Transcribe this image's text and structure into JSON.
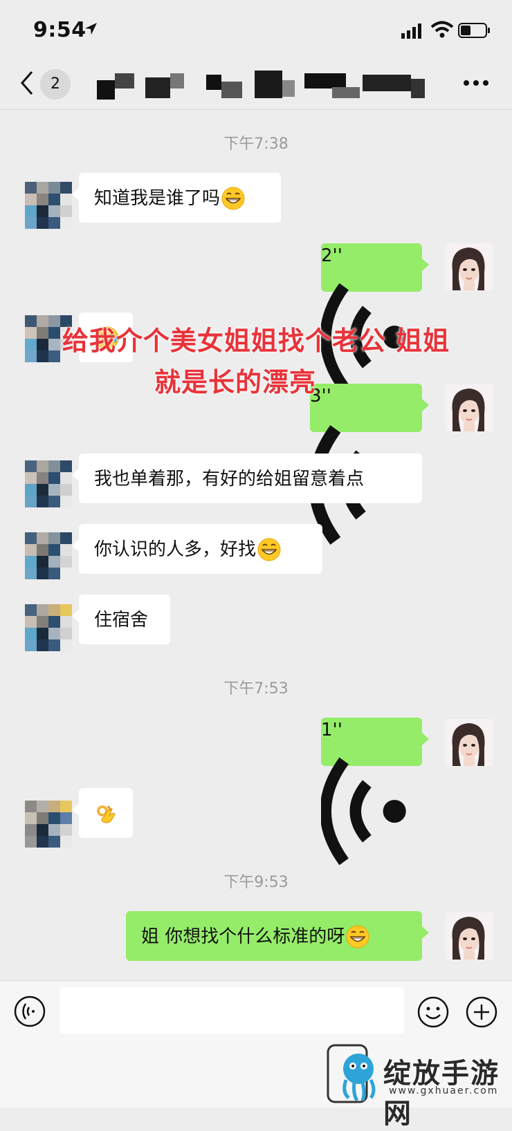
{
  "status_bar": {
    "time": "9:54"
  },
  "nav": {
    "unread_count": "2"
  },
  "timestamps": [
    "下午7:38",
    "下午7:53",
    "下午9:53"
  ],
  "messages": [
    {
      "side": "left",
      "type": "text",
      "text": "知道我是谁了吗",
      "emoji": "grinning-face"
    },
    {
      "side": "right",
      "type": "voice",
      "duration": "2''"
    },
    {
      "side": "left",
      "type": "emoji",
      "emoji": "face-with-tears-of-joy"
    },
    {
      "side": "right",
      "type": "voice",
      "duration": "3''"
    },
    {
      "side": "left",
      "type": "text",
      "text": "我也单着那，有好的给姐留意着点"
    },
    {
      "side": "left",
      "type": "text",
      "text": "你认识的人多，好找",
      "emoji": "grinning-face"
    },
    {
      "side": "left",
      "type": "text",
      "text": "住宿舍"
    },
    {
      "side": "right",
      "type": "voice",
      "duration": "1''"
    },
    {
      "side": "left",
      "type": "emoji",
      "emoji": "ok-hand"
    },
    {
      "side": "right",
      "type": "text",
      "text": "姐 你想找个什么标准的呀",
      "emoji": "grinning-face"
    }
  ],
  "overlay_caption": {
    "line1": "给我介个美女姐姐找个老公  姐姐",
    "line2": "就是长的漂亮"
  },
  "watermark": {
    "name": "绽放手游网",
    "url": "www.gxhuaer.com"
  },
  "colors": {
    "sent_bubble": "#95ec69",
    "received_bubble": "#ffffff",
    "background": "#ededed",
    "caption": "#e8333a"
  }
}
